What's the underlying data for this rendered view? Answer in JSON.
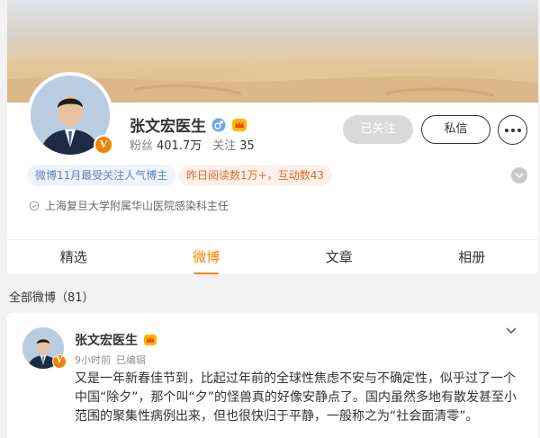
{
  "profile": {
    "name": "张文宏医生",
    "fans_label": "粉丝",
    "fans_count": "401.7万",
    "following_label": "关注",
    "following_count": "35",
    "verified_icon": "v-badge-icon",
    "gender_icon": "male-icon",
    "member_icon": "crown-icon"
  },
  "actions": {
    "followed_label": "已关注",
    "message_label": "私信",
    "more_icon": "more-icon"
  },
  "tags": {
    "blue": "微博11月最受关注人气博主",
    "orange": "昨日阅读数1万+，互动数43"
  },
  "org": {
    "text": "上海复旦大学附属华山医院感染科主任",
    "icon": "shield-icon"
  },
  "tabs": [
    {
      "label": "精选"
    },
    {
      "label": "微博"
    },
    {
      "label": "文章"
    },
    {
      "label": "相册"
    }
  ],
  "active_tab": "微博",
  "all_posts_label": "全部微博（81）",
  "post": {
    "author": "张文宏医生",
    "time": "9小时前",
    "edited": "已编辑",
    "text": "又是一年新春佳节到，比起过年前的全球性焦虑不安与不确定性，似乎过了一个中国“除夕”，那个叫“夕”的怪兽真的好像安静点了。国内虽然多地有散发甚至小范围的聚集性病例出来，但也很快归于平静，一般称之为“社会面清零”。"
  },
  "colors": {
    "accent": "#ff8200",
    "tag_blue_text": "#5b83ba",
    "tag_orange_text": "#e26a2c",
    "verified": "#f08300"
  }
}
